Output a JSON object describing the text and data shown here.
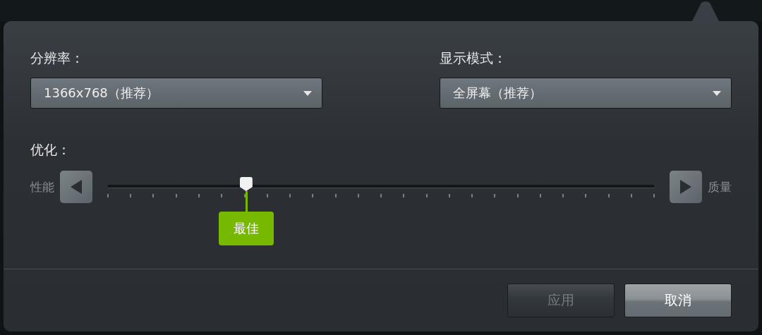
{
  "resolution": {
    "label": "分辨率：",
    "value": "1366x768（推荐）"
  },
  "display_mode": {
    "label": "显示模式：",
    "value": "全屏幕（推荐）"
  },
  "optimization": {
    "label": "优化：",
    "min_label": "性能",
    "max_label": "质量",
    "level": 0.253,
    "value_label": "最佳"
  },
  "buttons": [
    {
      "label": "应用",
      "disabled": true
    },
    {
      "label": "取消",
      "disabled": false
    }
  ]
}
